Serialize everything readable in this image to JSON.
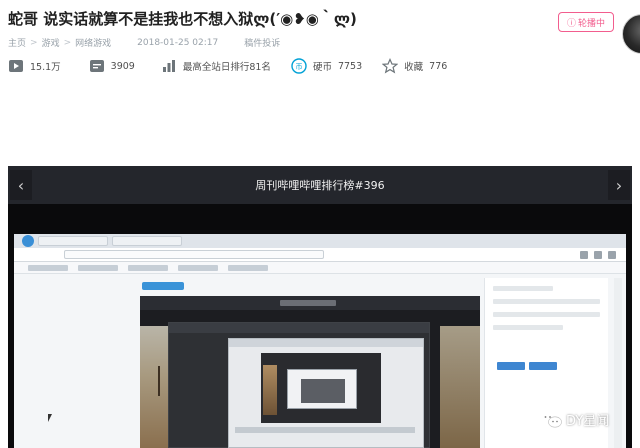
{
  "video": {
    "title": "蛇哥 说实话就算不是挂我也不想入狱ლ(′◉❥◉｀ლ)",
    "report_label": "稿件投诉",
    "live_label": "轮播中",
    "breadcrumb": [
      "主页",
      "游戏",
      "网络游戏"
    ],
    "upload_time": "2018-01-25 02:17"
  },
  "stats": {
    "views": "15.1万",
    "danmaku": "3909",
    "rank": "最高全站日排行81名",
    "coins_label": "硬币",
    "coins": "7753",
    "favorites_label": "收藏",
    "favorites": "776"
  },
  "player": {
    "title": "周刊哔哩哔哩排行榜#396"
  },
  "watermark": {
    "text": "DY星闻"
  },
  "colors": {
    "brand_pink": "#f25d8e",
    "player_bar": "#24262c",
    "meta_gray": "#99a2aa"
  },
  "icons": {
    "play": "play-icon",
    "danmaku": "danmaku-icon",
    "rank": "rank-icon",
    "coin": "coin-icon",
    "favorite": "star-icon",
    "report": "alert-icon"
  }
}
